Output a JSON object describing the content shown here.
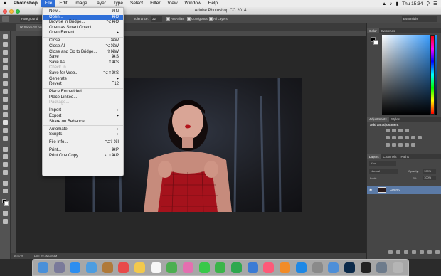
{
  "menubar": {
    "apple": "",
    "app": "Photoshop",
    "items": [
      "File",
      "Edit",
      "Image",
      "Layer",
      "Type",
      "Select",
      "Filter",
      "View",
      "Window",
      "Help"
    ],
    "clock": "Thu 15:34"
  },
  "window": {
    "title": "Adobe Photoshop CC 2014"
  },
  "options_bar": {
    "preset": "Foreground",
    "tolerance_label": "Tolerance:",
    "tolerance_value": "32",
    "anti_alias": "Anti-alias",
    "contiguous": "Contiguous",
    "all_layers": "All Layers",
    "workspace": "Essentials"
  },
  "document_tab": {
    "label": "IX Saom-18.psd @ 66.7%..."
  },
  "file_menu": {
    "rows": [
      {
        "label": "New...",
        "shortcut": "⌘N",
        "state": "normal"
      },
      {
        "label": "Open...",
        "shortcut": "⌘O",
        "state": "highlight"
      },
      {
        "label": "Browse in Bridge...",
        "shortcut": "⌥⌘O",
        "state": "normal"
      },
      {
        "label": "Open as Smart Object...",
        "shortcut": "",
        "state": "normal"
      },
      {
        "label": "Open Recent",
        "shortcut": "▸",
        "state": "normal"
      },
      {
        "sep": true
      },
      {
        "label": "Close",
        "shortcut": "⌘W",
        "state": "normal"
      },
      {
        "label": "Close All",
        "shortcut": "⌥⌘W",
        "state": "normal"
      },
      {
        "label": "Close and Go to Bridge...",
        "shortcut": "⇧⌘W",
        "state": "normal"
      },
      {
        "label": "Save",
        "shortcut": "⌘S",
        "state": "normal"
      },
      {
        "label": "Save As...",
        "shortcut": "⇧⌘S",
        "state": "normal"
      },
      {
        "label": "Check In...",
        "shortcut": "",
        "state": "disabled"
      },
      {
        "label": "Save for Web...",
        "shortcut": "⌥⇧⌘S",
        "state": "normal"
      },
      {
        "label": "Generate",
        "shortcut": "▸",
        "state": "normal"
      },
      {
        "label": "Revert",
        "shortcut": "F12",
        "state": "normal"
      },
      {
        "sep": true
      },
      {
        "label": "Place Embedded...",
        "shortcut": "",
        "state": "normal"
      },
      {
        "label": "Place Linked...",
        "shortcut": "",
        "state": "normal"
      },
      {
        "label": "Package...",
        "shortcut": "",
        "state": "disabled"
      },
      {
        "sep": true
      },
      {
        "label": "Import",
        "shortcut": "▸",
        "state": "normal"
      },
      {
        "label": "Export",
        "shortcut": "▸",
        "state": "normal"
      },
      {
        "label": "Share on Behance...",
        "shortcut": "",
        "state": "normal"
      },
      {
        "sep": true
      },
      {
        "label": "Automate",
        "shortcut": "▸",
        "state": "normal"
      },
      {
        "label": "Scripts",
        "shortcut": "▸",
        "state": "normal"
      },
      {
        "sep": true
      },
      {
        "label": "File Info...",
        "shortcut": "⌥⇧⌘I",
        "state": "normal"
      },
      {
        "sep": true
      },
      {
        "label": "Print...",
        "shortcut": "⌘P",
        "state": "normal"
      },
      {
        "label": "Print One Copy",
        "shortcut": "⌥⇧⌘P",
        "state": "normal"
      }
    ]
  },
  "panels": {
    "color_tabs": [
      "Color",
      "Swatches"
    ],
    "adjust_tabs": [
      "Adjustments",
      "Styles"
    ],
    "adjust_title": "Add an adjustment",
    "layers_tabs": [
      "Layers",
      "Channels",
      "Paths"
    ],
    "layers_filter": "Kind",
    "blend_mode": "Normal",
    "opacity_label": "Opacity:",
    "opacity_value": "100%",
    "lock_label": "Lock:",
    "fill_label": "Fill:",
    "fill_value": "100%",
    "layer_name": "Layer 0"
  },
  "status": {
    "zoom": "66.67%",
    "doc": "Doc: 29.3M/29.3M"
  },
  "dock_icons": [
    "Finder",
    "Launchpad",
    "Safari",
    "Mail",
    "Contacts",
    "Calendar",
    "Notes",
    "Reminders",
    "Maps",
    "Photos",
    "Messages",
    "FaceTime",
    "Numbers",
    "Keynote",
    "iTunes",
    "iBooks",
    "App Store",
    "System Preferences",
    "Preview",
    "Photoshop",
    "Terminal",
    "Finder Window",
    "Trash"
  ],
  "colors": {
    "accent": "#2f6fd8",
    "app_bg": "#535353"
  }
}
